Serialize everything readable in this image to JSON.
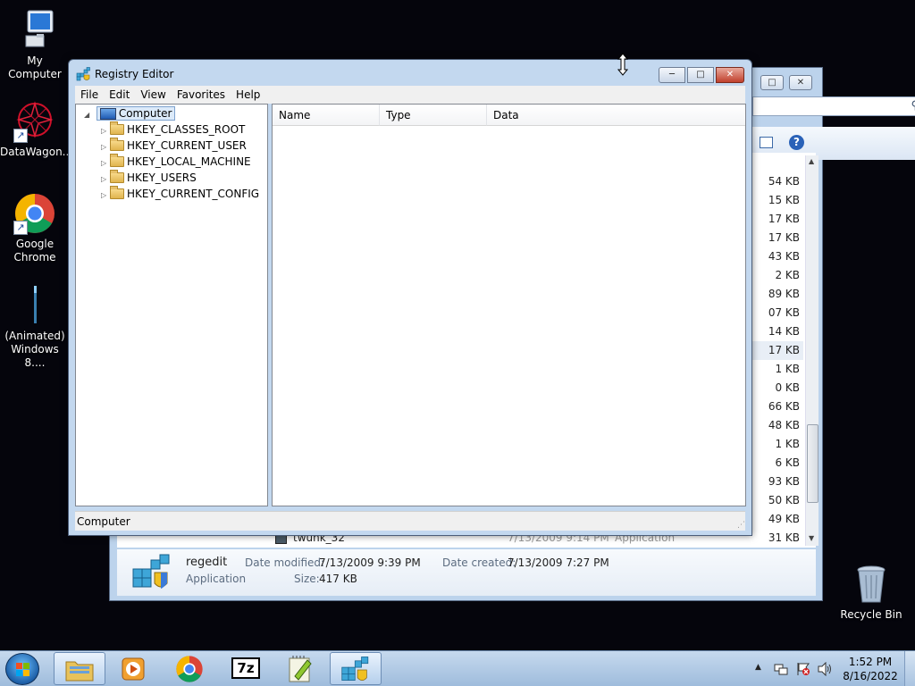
{
  "desktop": {
    "icons": [
      {
        "label": "My Computer"
      },
      {
        "label": "DataWagon..."
      },
      {
        "label": "Google Chrome"
      },
      {
        "label": "(Animated) Windows 8...."
      },
      {
        "label": "Recycle Bin"
      }
    ]
  },
  "explorer": {
    "sizes": [
      "54 KB",
      "15 KB",
      "17 KB",
      "17 KB",
      "43 KB",
      "2 KB",
      "89 KB",
      "07 KB",
      "14 KB",
      "17 KB",
      "1 KB",
      "0 KB",
      "66 KB",
      "48 KB",
      "1 KB",
      "6 KB",
      "93 KB",
      "50 KB",
      "49 KB",
      "31 KB"
    ],
    "peek_row": {
      "name": "twunk_32",
      "date": "7/13/2009 9:14 PM",
      "type": "Application"
    },
    "details": {
      "name": "regedit",
      "kind": "Application",
      "date_modified_label": "Date modified:",
      "date_modified": "7/13/2009 9:39 PM",
      "date_created_label": "Date created:",
      "date_created": "7/13/2009 7:27 PM",
      "size_label": "Size:",
      "size": "417 KB"
    }
  },
  "regedit": {
    "title": "Registry Editor",
    "menu": [
      "File",
      "Edit",
      "View",
      "Favorites",
      "Help"
    ],
    "tree_root": "Computer",
    "keys": [
      "HKEY_CLASSES_ROOT",
      "HKEY_CURRENT_USER",
      "HKEY_LOCAL_MACHINE",
      "HKEY_USERS",
      "HKEY_CURRENT_CONFIG"
    ],
    "columns": [
      "Name",
      "Type",
      "Data"
    ],
    "status": "Computer"
  },
  "taskbar": {
    "apps": [
      "windows-explorer",
      "media-player",
      "google-chrome",
      "7-zip",
      "notepad-plus-plus",
      "registry-editor"
    ],
    "time": "1:52 PM",
    "date": "8/16/2022"
  },
  "colors": {
    "desktop": "#05050c",
    "window_frame": "#c3d8ef",
    "close_button": "#c0402c"
  }
}
